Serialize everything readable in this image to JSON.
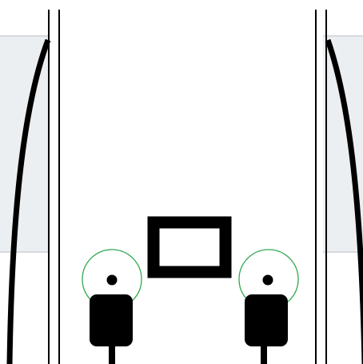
{
  "colors": {
    "background": "#ffffff",
    "band_fill": "#eceff1",
    "band_border": "#d5dadf",
    "outline": "#000000",
    "tap_target_ring": "#2ea84f"
  },
  "elements": {
    "left_port": {
      "icon": "usb-plug-icon",
      "ring": "tap-target-ring"
    },
    "right_port": {
      "icon": "usb-plug-icon",
      "ring": "tap-target-ring"
    },
    "center_slot": {
      "icon": "rectangle-outline-icon"
    }
  }
}
